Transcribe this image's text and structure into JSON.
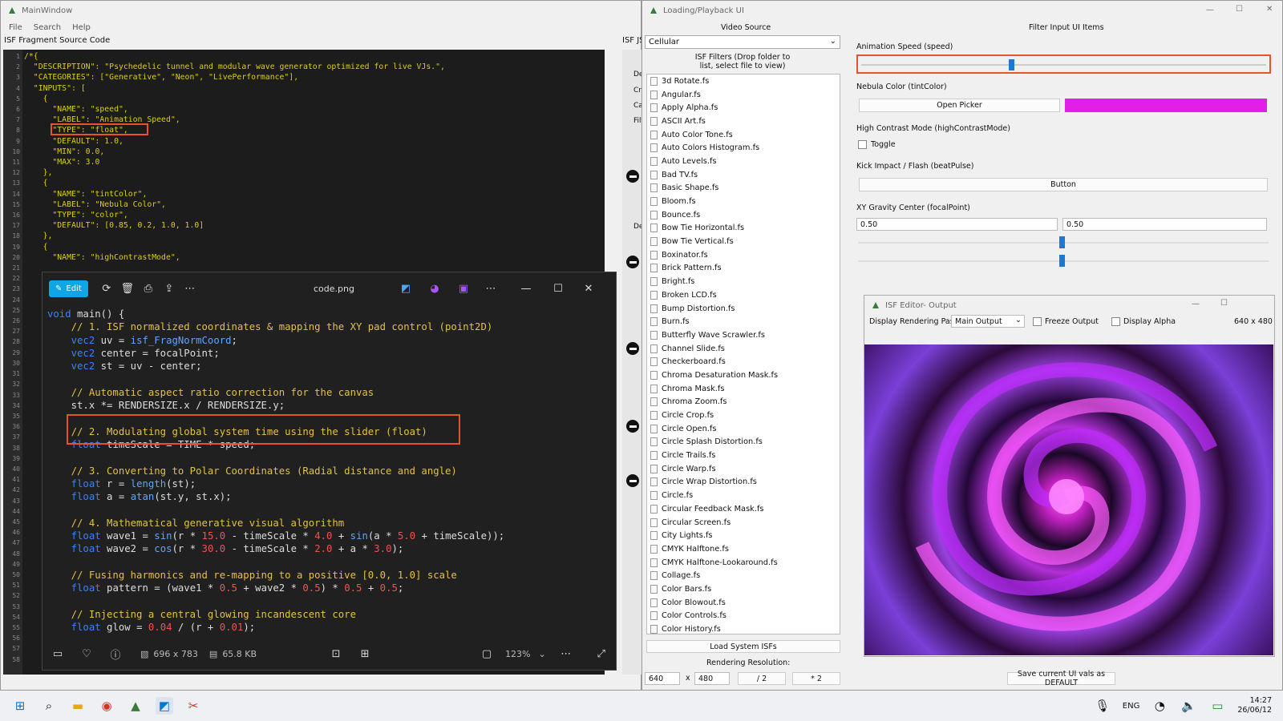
{
  "main_window": {
    "title": "MainWindow",
    "menu": [
      "File",
      "Search",
      "Help"
    ],
    "source_label": "ISF Fragment Source Code",
    "isf_js_label": "ISF JS",
    "side_labels": [
      "De",
      "Cre",
      "Ca",
      "Filt",
      "De"
    ],
    "code_lines": [
      "/*{",
      "  \"DESCRIPTION\": \"Psychedelic tunnel and modular wave generator optimized for live VJs.\",",
      "  \"CATEGORIES\": [\"Generative\", \"Neon\", \"LivePerformance\"],",
      "  \"INPUTS\": [",
      "    {",
      "      \"NAME\": \"speed\",",
      "      \"LABEL\": \"Animation Speed\",",
      "      \"TYPE\": \"float\",",
      "      \"DEFAULT\": 1.0,",
      "      \"MIN\": 0.0,",
      "      \"MAX\": 3.0",
      "    },",
      "    {",
      "      \"NAME\": \"tintColor\",",
      "      \"LABEL\": \"Nebula Color\",",
      "      \"TYPE\": \"color\",",
      "      \"DEFAULT\": [0.85, 0.2, 1.0, 1.0]",
      "    },",
      "    {",
      "      \"NAME\": \"highContrastMode\","
    ]
  },
  "viewer": {
    "edit_label": "Edit",
    "file_name": "code.png",
    "dimensions": "696 x 783",
    "file_size": "65.8 KB",
    "zoom": "123%",
    "code_lines": [
      "void main() {",
      "    // 1. ISF normalized coordinates & mapping the XY pad control (point2D)",
      "    vec2 uv = isf_FragNormCoord;",
      "    vec2 center = focalPoint;",
      "    vec2 st = uv - center;",
      "",
      "    // Automatic aspect ratio correction for the canvas",
      "    st.x *= RENDERSIZE.x / RENDERSIZE.y;",
      "",
      "    // 2. Modulating global system time using the slider (float)",
      "    float timeScale = TIME * speed;",
      "",
      "    // 3. Converting to Polar Coordinates (Radial distance and angle)",
      "    float r = length(st);",
      "    float a = atan(st.y, st.x);",
      "",
      "    // 4. Mathematical generative visual algorithm",
      "    float wave1 = sin(r * 15.0 - timeScale * 4.0 + sin(a * 5.0 + timeScale));",
      "    float wave2 = cos(r * 30.0 - timeScale * 2.0 + a * 3.0);",
      "",
      "    // Fusing harmonics and re-mapping to a positive [0.0, 1.0] scale",
      "    float pattern = (wave1 * 0.5 + wave2 * 0.5) * 0.5 + 0.5;",
      "",
      "    // Injecting a central glowing incandescent core",
      "    float glow = 0.04 / (r + 0.01);"
    ]
  },
  "loading_window": {
    "title": "Loading/Playback UI",
    "video_source_label": "Video Source",
    "video_source_value": "Cellular",
    "filters_label": "ISF Filters (Drop folder to list, select file to view)",
    "filters": [
      "3d Rotate.fs",
      "Angular.fs",
      "Apply Alpha.fs",
      "ASCII Art.fs",
      "Auto Color Tone.fs",
      "Auto Colors Histogram.fs",
      "Auto Levels.fs",
      "Bad TV.fs",
      "Basic Shape.fs",
      "Bloom.fs",
      "Bounce.fs",
      "Bow Tie Horizontal.fs",
      "Bow Tie Vertical.fs",
      "Boxinator.fs",
      "Brick Pattern.fs",
      "Bright.fs",
      "Broken LCD.fs",
      "Bump Distortion.fs",
      "Burn.fs",
      "Butterfly Wave Scrawler.fs",
      "Channel Slide.fs",
      "Checkerboard.fs",
      "Chroma Desaturation Mask.fs",
      "Chroma Mask.fs",
      "Chroma Zoom.fs",
      "Circle Crop.fs",
      "Circle Open.fs",
      "Circle Splash Distortion.fs",
      "Circle Trails.fs",
      "Circle Warp.fs",
      "Circle Wrap Distortion.fs",
      "Circle.fs",
      "Circular Feedback Mask.fs",
      "Circular Screen.fs",
      "City Lights.fs",
      "CMYK Halftone.fs",
      "CMYK Halftone-Lookaround.fs",
      "Collage.fs",
      "Color Bars.fs",
      "Color Blowout.fs",
      "Color Controls.fs",
      "Color History.fs"
    ],
    "load_system_label": "Load System ISFs",
    "rendering_resolution_label": "Rendering Resolution:",
    "res_w": "640",
    "res_h": "480",
    "res_x": "x",
    "half_label": "/ 2",
    "double_label": "* 2",
    "filter_input_label": "Filter Input UI Items",
    "animation_speed_label": "Animation Speed (speed)",
    "animation_speed_value": 0.37,
    "nebula_label": "Nebula Color (tintColor)",
    "open_picker_label": "Open Picker",
    "nebula_color": "#e020e8",
    "contrast_label": "High Contrast Mode (highContrastMode)",
    "toggle_label": "Toggle",
    "kick_label": "Kick Impact / Flash (beatPulse)",
    "button_label": "Button",
    "xy_label": "XY Gravity Center (focalPoint)",
    "xy_x": "0.50",
    "xy_y": "0.50",
    "save_default_label": "Save current UI vals as DEFAULT"
  },
  "output_window": {
    "title": "ISF Editor- Output",
    "rendering_pass_label": "Display Rendering Pass:",
    "rendering_pass_value": "Main Output",
    "freeze_label": "Freeze Output",
    "alpha_label": "Display Alpha",
    "size_label": "640 x 480"
  },
  "taskbar": {
    "lang": "ENG",
    "time": "14:27",
    "date": "26/06/12"
  },
  "accent_color": "#e8542a"
}
